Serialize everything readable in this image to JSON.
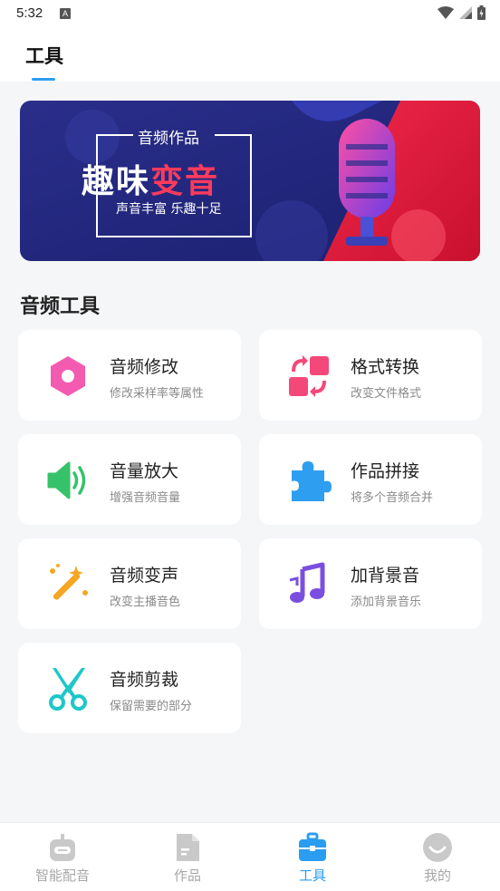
{
  "status_bar": {
    "time": "5:32",
    "badge": "A"
  },
  "header": {
    "title": "工具"
  },
  "banner": {
    "small_title": "音频作品",
    "title_part1": "趣味",
    "title_part2": "变音",
    "subtitle": "声音丰富 乐趣十足"
  },
  "section": {
    "title": "音频工具"
  },
  "tools": [
    {
      "title": "音频修改",
      "desc": "修改采样率等属性",
      "icon": "hexagon-icon",
      "color": "#f25bb0"
    },
    {
      "title": "格式转换",
      "desc": "改变文件格式",
      "icon": "convert-icon",
      "color": "#f5487a"
    },
    {
      "title": "音量放大",
      "desc": "增强音频音量",
      "icon": "speaker-icon",
      "color": "#36c26a"
    },
    {
      "title": "作品拼接",
      "desc": "将多个音频合并",
      "icon": "puzzle-icon",
      "color": "#2e9ff0"
    },
    {
      "title": "音频变声",
      "desc": "改变主播音色",
      "icon": "magic-wand-icon",
      "color": "#f5a623"
    },
    {
      "title": "加背景音",
      "desc": "添加背景音乐",
      "icon": "music-note-icon",
      "color": "#7a4fe0"
    },
    {
      "title": "音频剪裁",
      "desc": "保留需要的部分",
      "icon": "scissors-icon",
      "color": "#1ec7c9"
    }
  ],
  "nav": [
    {
      "label": "智能配音",
      "icon": "robot-icon"
    },
    {
      "label": "作品",
      "icon": "document-icon"
    },
    {
      "label": "工具",
      "icon": "toolbox-icon",
      "active": true
    },
    {
      "label": "我的",
      "icon": "profile-icon"
    }
  ],
  "colors": {
    "accent": "#2b9df0",
    "inactive": "#a7a7a7"
  }
}
